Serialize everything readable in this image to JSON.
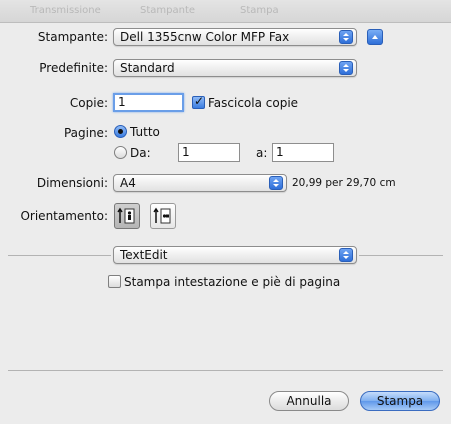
{
  "background_bar": {
    "ghost_items": [
      "Transmissione",
      "Stampante",
      "Stampa"
    ]
  },
  "printer": {
    "label": "Stampante:",
    "value": "Dell 1355cnw Color MFP Fax"
  },
  "presets": {
    "label": "Predefinite:",
    "value": "Standard"
  },
  "copies": {
    "label": "Copie:",
    "value": "1",
    "collate_label": "Fascicola copie",
    "collate_checked": true
  },
  "pages": {
    "label": "Pagine:",
    "all_label": "Tutto",
    "all_selected": true,
    "from_label": "Da:",
    "from_value": "1",
    "to_label": "a:",
    "to_value": "1"
  },
  "paper_size": {
    "label": "Dimensioni:",
    "value": "A4",
    "dimensions_text": "20,99 per 29,70 cm"
  },
  "orientation": {
    "label": "Orientamento:",
    "selected": "portrait"
  },
  "app_section": {
    "value": "TextEdit"
  },
  "header_footer": {
    "label": "Stampa intestazione e piè di pagina",
    "checked": false
  },
  "buttons": {
    "cancel": "Annulla",
    "print": "Stampa"
  },
  "colors": {
    "accent": "#3b7de0",
    "panel": "#ececec",
    "focus_ring": "#6a9ee8"
  }
}
